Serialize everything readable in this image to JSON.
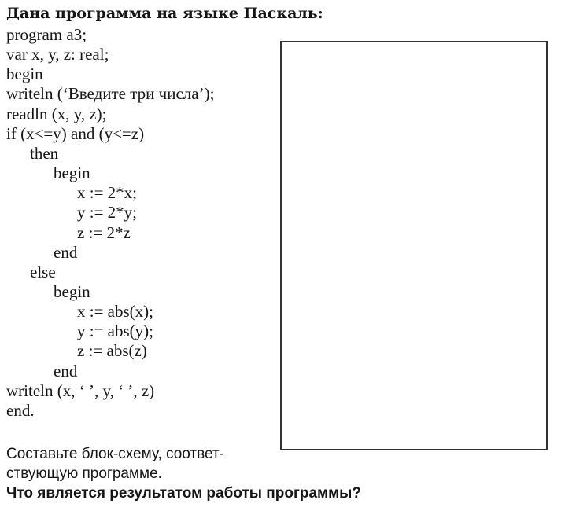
{
  "title": "Дана программа на языке Паскаль:",
  "code": [
    {
      "indent": 0,
      "text": "program a3;"
    },
    {
      "indent": 0,
      "text": "var x, y, z: real;"
    },
    {
      "indent": 0,
      "text": "begin"
    },
    {
      "indent": 0,
      "text": "writeln (‘Введите три числа’);"
    },
    {
      "indent": 0,
      "text": "readln (x, y, z);"
    },
    {
      "indent": 0,
      "text": "if (x<=y) and (y<=z)"
    },
    {
      "indent": 1,
      "text": "then"
    },
    {
      "indent": 2,
      "text": "begin"
    },
    {
      "indent": 3,
      "text": "x := 2*x;"
    },
    {
      "indent": 3,
      "text": "y := 2*y;"
    },
    {
      "indent": 3,
      "text": "z := 2*z"
    },
    {
      "indent": 2,
      "text": "end"
    },
    {
      "indent": 1,
      "text": "else"
    },
    {
      "indent": 2,
      "text": "begin"
    },
    {
      "indent": 3,
      "text": "x := abs(x);"
    },
    {
      "indent": 3,
      "text": "y := abs(y);"
    },
    {
      "indent": 3,
      "text": "z := abs(z)"
    },
    {
      "indent": 2,
      "text": "end"
    },
    {
      "indent": 0,
      "text": "writeln (x, ‘ ’, y, ‘ ’, z)"
    },
    {
      "indent": 0,
      "text": "end."
    }
  ],
  "task": [
    "Составьте блок-схему, соответ-",
    "ствующую программе."
  ],
  "question": "Что является результатом работы программы?"
}
